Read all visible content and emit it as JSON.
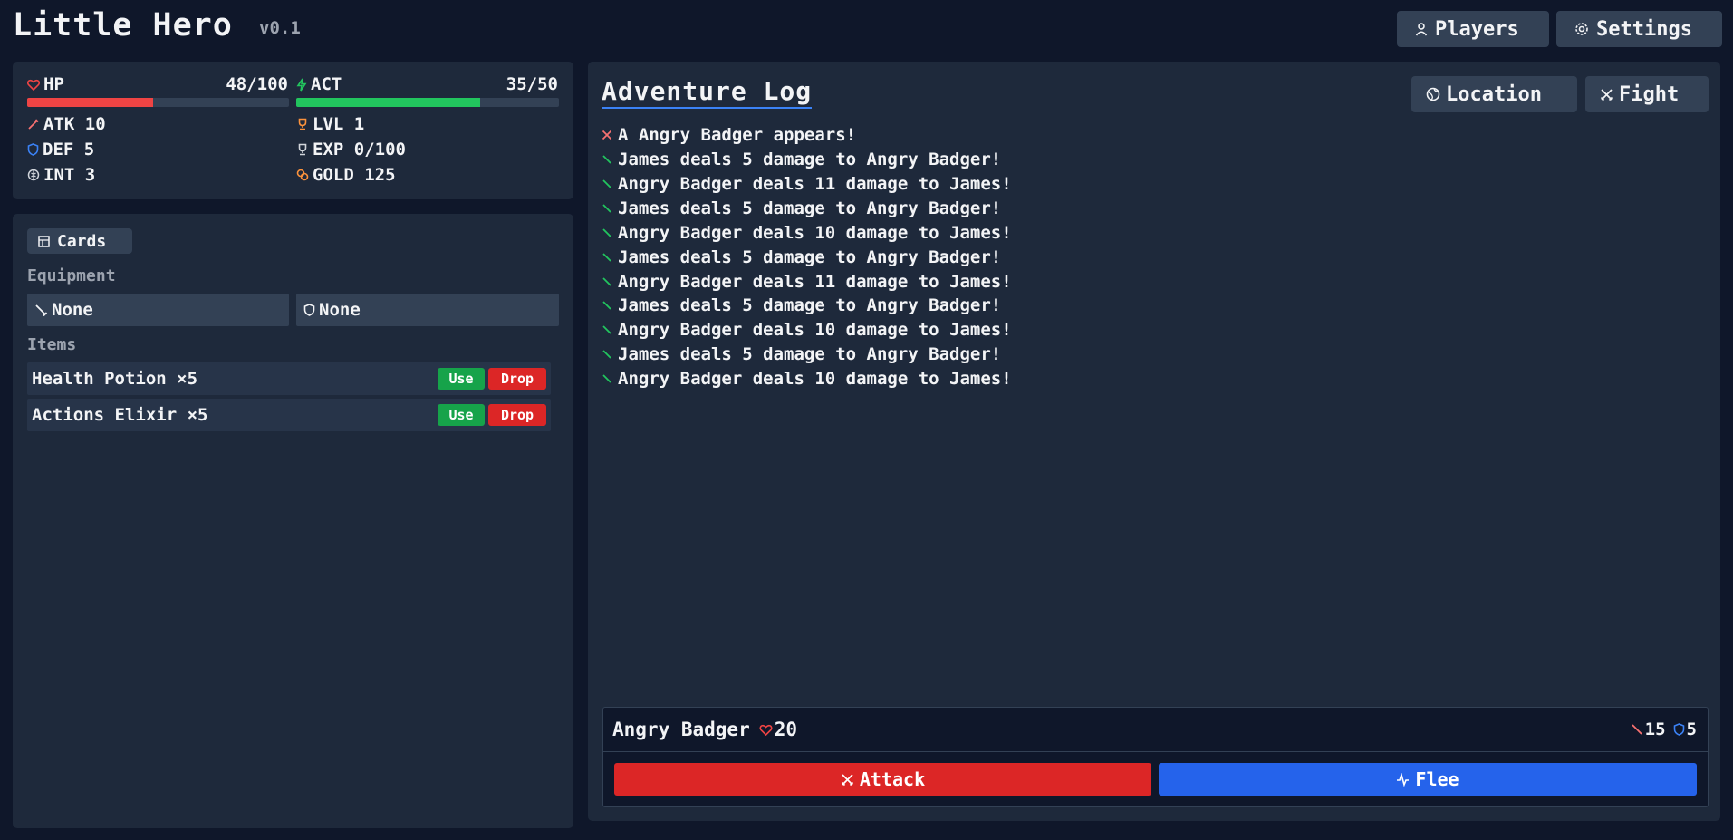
{
  "header": {
    "title": "Little Hero",
    "version": "v0.1",
    "players_label": "Players",
    "settings_label": "Settings"
  },
  "stats": {
    "hp_label": "HP",
    "hp_value": "48/100",
    "hp_fraction": 0.48,
    "act_label": "ACT",
    "act_value": "35/50",
    "act_fraction": 0.7,
    "atk": "ATK 10",
    "lvl": "LVL 1",
    "def": "DEF 5",
    "exp": "EXP 0/100",
    "int": "INT 3",
    "gold": "GOLD 125"
  },
  "inventory": {
    "tab_label": "Cards",
    "equipment_label": "Equipment",
    "weapon_slot": "None",
    "armor_slot": "None",
    "items_label": "Items",
    "items": [
      {
        "name": "Health Potion ×5",
        "use": "Use",
        "drop": "Drop"
      },
      {
        "name": "Actions Elixir ×5",
        "use": "Use",
        "drop": "Drop"
      }
    ]
  },
  "log": {
    "title": "Adventure Log",
    "location_label": "Location",
    "fight_label": "Fight",
    "lines": [
      "A Angry Badger appears!",
      "James deals 5 damage to Angry Badger!",
      "Angry Badger deals 11 damage to James!",
      "James deals 5 damage to Angry Badger!",
      "Angry Badger deals 10 damage to James!",
      "James deals 5 damage to Angry Badger!",
      "Angry Badger deals 11 damage to James!",
      "James deals 5 damage to Angry Badger!",
      "Angry Badger deals 10 damage to James!",
      "James deals 5 damage to Angry Badger!",
      "Angry Badger deals 10 damage to James!"
    ]
  },
  "enemy": {
    "name": "Angry Badger",
    "hp": "20",
    "atk": "15",
    "def": "5",
    "attack_label": "Attack",
    "flee_label": "Flee"
  },
  "colors": {
    "hp_bar": "#ef4444",
    "act_bar": "#22c55e",
    "attack": "#dc2626",
    "flee": "#2563eb"
  },
  "icons": {
    "hp": "heart-icon",
    "act": "lightning-icon",
    "atk": "sword-icon",
    "def": "shield-icon",
    "int": "brain-icon",
    "lvl": "trophy-icon",
    "exp": "trophy-outline-icon",
    "gold": "coins-icon"
  }
}
